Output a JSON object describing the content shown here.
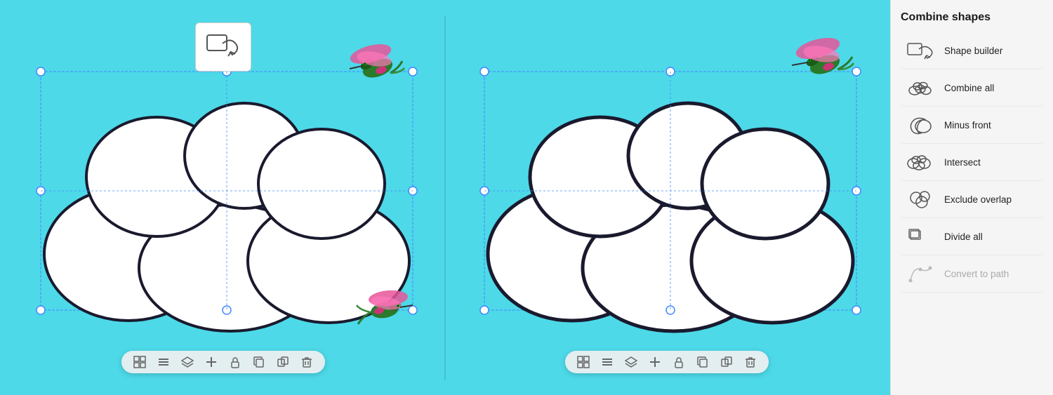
{
  "sidebar": {
    "title": "Combine shapes",
    "items": [
      {
        "id": "shape-builder",
        "label": "Shape builder",
        "disabled": false
      },
      {
        "id": "combine-all",
        "label": "Combine all",
        "disabled": false
      },
      {
        "id": "minus-front",
        "label": "Minus front",
        "disabled": false
      },
      {
        "id": "intersect",
        "label": "Intersect",
        "disabled": false
      },
      {
        "id": "exclude-overlap",
        "label": "Exclude overlap",
        "disabled": false
      },
      {
        "id": "divide-all",
        "label": "Divide all",
        "disabled": false
      },
      {
        "id": "convert-to-path",
        "label": "Convert to path",
        "disabled": true
      }
    ]
  },
  "toolbar": {
    "icons": [
      "grid",
      "menu",
      "layers",
      "plus",
      "lock",
      "copy",
      "group-copy",
      "trash"
    ]
  }
}
